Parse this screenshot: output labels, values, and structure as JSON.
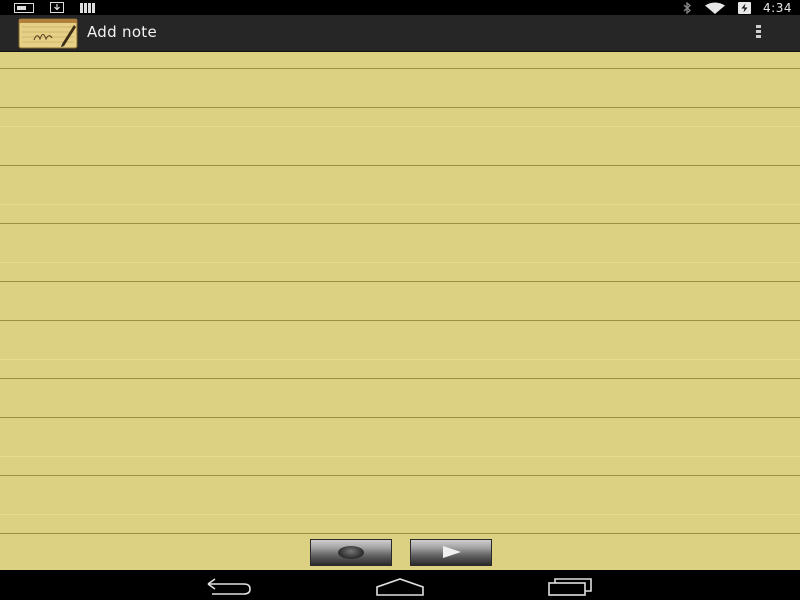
{
  "status_bar": {
    "time": "4:34",
    "left_icons": [
      "notification-card-icon",
      "download-icon",
      "signal-bars-icon"
    ],
    "right_icons": [
      "bluetooth-icon",
      "wifi-icon",
      "battery-charging-icon"
    ]
  },
  "action_bar": {
    "title": "Add note",
    "app_icon": "notepad-icon",
    "menu_icon": "overflow-menu-icon"
  },
  "note": {
    "text": "",
    "paper_color": "#dcd083",
    "line_color": "#9b8f47"
  },
  "controls": {
    "record_icon": "record-icon",
    "play_icon": "play-icon"
  },
  "nav_bar": {
    "icons": [
      "back-icon",
      "home-icon",
      "recent-apps-icon"
    ]
  }
}
